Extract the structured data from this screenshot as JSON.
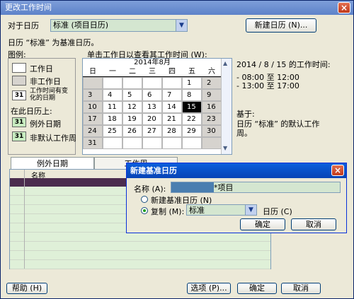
{
  "window": {
    "title": "更改工作时间",
    "close": "×"
  },
  "for_calendar": {
    "label": "对于日历",
    "value": "标准 (项目日历)",
    "new_calendar_button": "新建日历 (N)..."
  },
  "base_note": "日历 “标准” 为基准日历。",
  "legend": {
    "title": "图例:",
    "items": [
      {
        "label": "工作日",
        "color": "#ffffff"
      },
      {
        "label": "非工作日",
        "color": "#d6d3ce"
      },
      {
        "label": "工作时间有变化的日期",
        "glyph": "31"
      }
    ],
    "on_this_calendar": "在此日历上:",
    "items2": [
      {
        "label": "例外日期",
        "glyph": "31"
      },
      {
        "label": "非默认工作周",
        "glyph": "31"
      }
    ]
  },
  "calendar": {
    "instruction": "单击工作日以查看其工作时间 (W):",
    "month": "2014年8月",
    "weekdays": [
      "日",
      "一",
      "二",
      "三",
      "四",
      "五",
      "六"
    ],
    "weeks": [
      [
        "",
        "",
        "",
        "",
        "",
        "1",
        "2"
      ],
      [
        "3",
        "4",
        "5",
        "6",
        "7",
        "8",
        "9"
      ],
      [
        "10",
        "11",
        "12",
        "13",
        "14",
        "15",
        "16"
      ],
      [
        "17",
        "18",
        "19",
        "20",
        "21",
        "22",
        "23"
      ],
      [
        "24",
        "25",
        "26",
        "27",
        "28",
        "29",
        "30"
      ],
      [
        "31",
        "",
        "",
        "",
        "",
        "",
        ""
      ]
    ],
    "selected": "15"
  },
  "work_time": {
    "heading": "2014 / 8 / 15 的工作时间:",
    "slots": [
      "- 08:00 至 12:00",
      "- 13:00 至 17:00"
    ],
    "based_on_label": "基于:",
    "based_on_text": "日历 “标准” 的默认工作周。"
  },
  "tabs": {
    "exceptions": "例外日期",
    "work_weeks": "工作周"
  },
  "grid": {
    "column_name": "名称"
  },
  "bottom": {
    "help": "帮助 (H)",
    "options": "选项 (P)...",
    "ok": "确定",
    "cancel": "取消"
  },
  "dialog": {
    "title": "新建基准日历",
    "name_label": "名称 (A):",
    "name_value": "*项目",
    "option_new": "新建基准日历 (N)",
    "option_copy": "复制 (M):",
    "copy_value": "标准",
    "copy_suffix": "日历 (C)",
    "ok": "确定",
    "cancel": "取消"
  }
}
